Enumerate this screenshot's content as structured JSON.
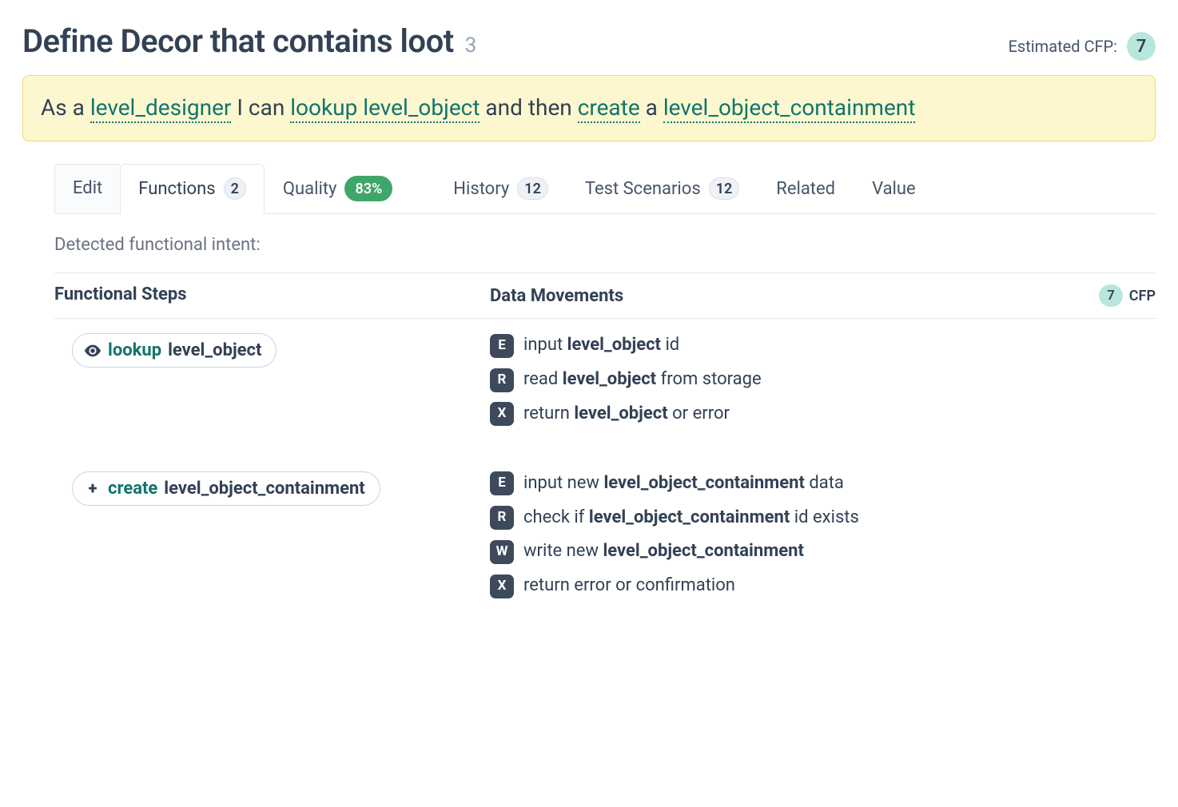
{
  "header": {
    "title": "Define Decor that contains loot",
    "title_count": "3",
    "cfp_label": "Estimated CFP:",
    "cfp_value": "7"
  },
  "story": {
    "prefix": "As a ",
    "role": "level_designer",
    "mid1": " I can ",
    "action1": "lookup level_object",
    "mid2": " and then ",
    "action2": "create",
    "mid3": " a ",
    "object": "level_object_containment"
  },
  "tabs": {
    "edit": "Edit",
    "functions": {
      "label": "Functions",
      "count": "2"
    },
    "quality": {
      "label": "Quality",
      "pct": "83%"
    },
    "history": {
      "label": "History",
      "count": "12"
    },
    "tests": {
      "label": "Test Scenarios",
      "count": "12"
    },
    "related": "Related",
    "value": "Value"
  },
  "intent_label": "Detected functional intent:",
  "columns": {
    "steps": "Functional Steps",
    "moves": "Data Movements",
    "cfp_value": "7",
    "cfp_unit": "CFP"
  },
  "steps": [
    {
      "icon": "eye",
      "verb": "lookup",
      "object": "level_object",
      "moves": [
        {
          "code": "E",
          "pre": "input ",
          "bold": "level_object",
          "post": " id"
        },
        {
          "code": "R",
          "pre": "read ",
          "bold": "level_object",
          "post": " from storage"
        },
        {
          "code": "X",
          "pre": "return ",
          "bold": "level_object",
          "post": " or error"
        }
      ]
    },
    {
      "icon": "plus",
      "verb": "create",
      "object": "level_object_containment",
      "moves": [
        {
          "code": "E",
          "pre": "input new ",
          "bold": "level_object_containment",
          "post": " data"
        },
        {
          "code": "R",
          "pre": "check if ",
          "bold": "level_object_containment",
          "post": " id exists"
        },
        {
          "code": "W",
          "pre": "write new ",
          "bold": "level_object_containment",
          "post": ""
        },
        {
          "code": "X",
          "pre": "return error or confirmation",
          "bold": "",
          "post": ""
        }
      ]
    }
  ]
}
